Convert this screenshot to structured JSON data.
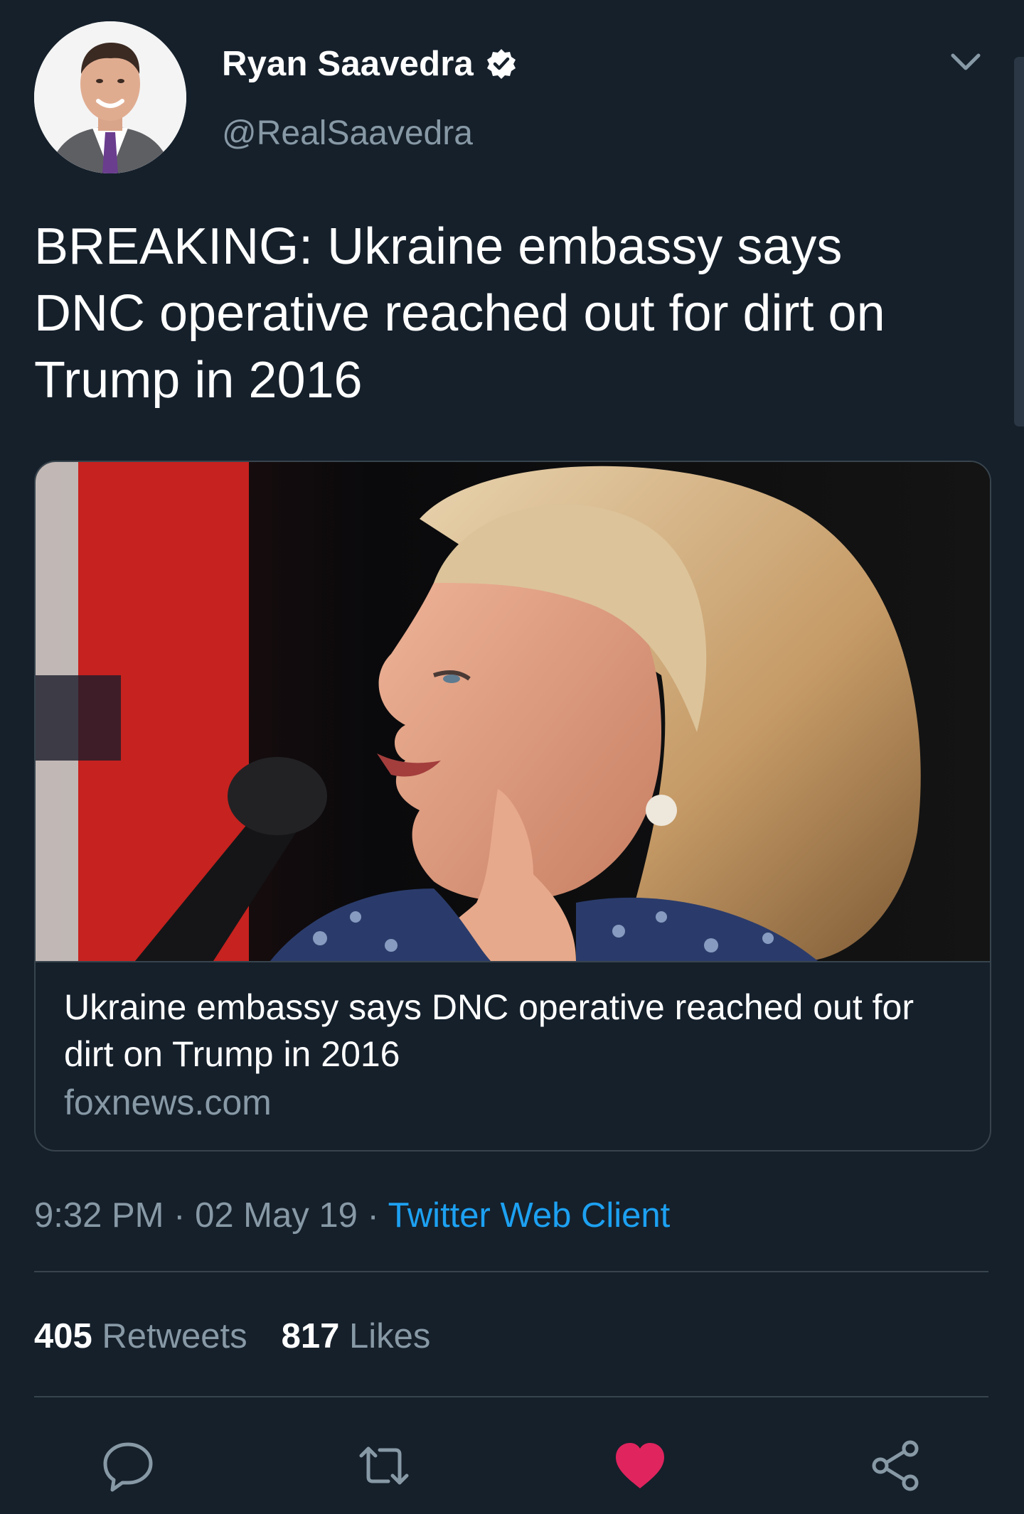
{
  "author": {
    "display_name": "Ryan Saavedra",
    "handle": "@RealSaavedra",
    "verified": true
  },
  "tweet": {
    "text": "BREAKING: Ukraine embassy says DNC operative reached out for dirt on Trump in 2016"
  },
  "card": {
    "title": "Ukraine embassy says DNC operative reached out for dirt on Trump in 2016",
    "domain": "foxnews.com"
  },
  "meta": {
    "time": "9:32 PM",
    "separator": "·",
    "date": "02 May 19",
    "client": "Twitter Web Client"
  },
  "stats": {
    "retweets_count": "405",
    "retweets_label": "Retweets",
    "likes_count": "817",
    "likes_label": "Likes"
  },
  "icons": {
    "reply": "reply-icon",
    "retweet": "retweet-icon",
    "like": "heart-icon",
    "share": "share-icon",
    "more": "chevron-down-icon",
    "verified": "verified-badge-icon"
  },
  "colors": {
    "background": "#15202b",
    "accent": "#1da1f2",
    "like": "#e0245e",
    "secondary_text": "#8899a6",
    "border": "#38444d"
  }
}
